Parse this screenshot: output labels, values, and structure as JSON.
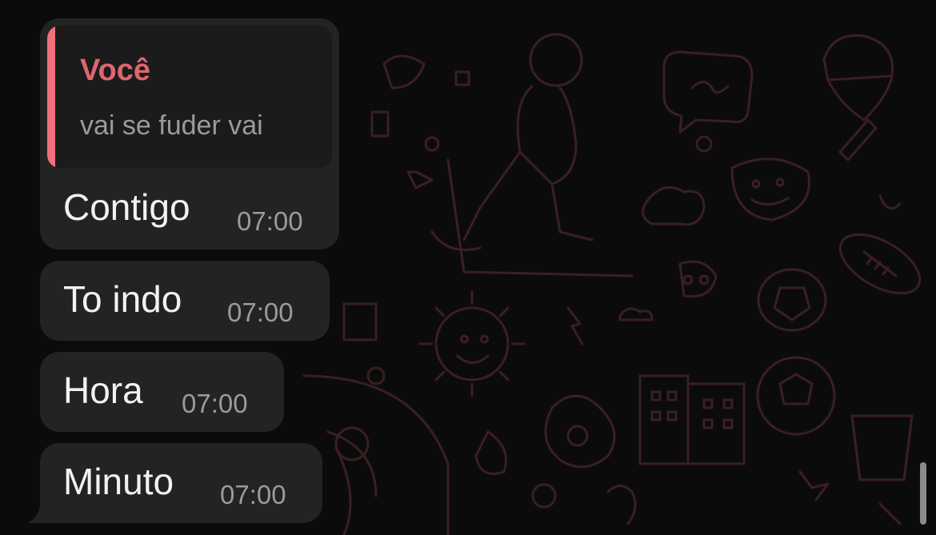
{
  "theme": {
    "bubble_color": "#222423",
    "reply_accent": "#f0707a",
    "reply_author_color": "#e0656e",
    "background": "#0c0b0b"
  },
  "messages": [
    {
      "reply": {
        "author": "Você",
        "text": "vai se fuder vai"
      },
      "text": "Contigo",
      "time": "07:00"
    },
    {
      "text": "To indo",
      "time": "07:00"
    },
    {
      "text": "Hora",
      "time": "07:00"
    },
    {
      "text": "Minuto",
      "time": "07:00"
    }
  ]
}
